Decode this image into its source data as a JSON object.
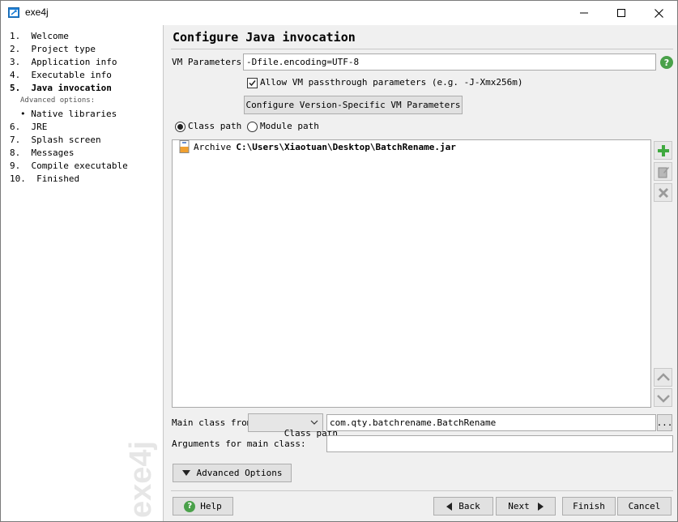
{
  "window": {
    "title": "exe4j"
  },
  "sidebar": {
    "steps": [
      {
        "label": "1.  Welcome"
      },
      {
        "label": "2.  Project type"
      },
      {
        "label": "3.  Application info"
      },
      {
        "label": "4.  Executable info"
      },
      {
        "label": "5.  Java invocation"
      },
      {
        "label": "6.  JRE"
      },
      {
        "label": "7.  Splash screen"
      },
      {
        "label": "8.  Messages"
      },
      {
        "label": "9.  Compile executable"
      },
      {
        "label": "10.  Finished"
      }
    ],
    "advanced_label": "Advanced options:",
    "sub_item": "• Native libraries",
    "watermark": "exe4j"
  },
  "main": {
    "title": "Configure Java invocation",
    "vm_params_label": "VM Parameters:",
    "vm_params_value": "-Dfile.encoding=UTF-8",
    "help_glyph": "?",
    "passthrough_label": "Allow VM passthrough parameters (e.g. -J-Xmx256m)",
    "passthrough_checked": true,
    "configure_version_button": "Configure Version-Specific VM Parameters",
    "classpath_radio": "Class path",
    "modulepath_radio": "Module path",
    "classpath_entries": [
      {
        "type": "Archive",
        "path": "C:\\Users\\Xiaotuan\\Desktop\\BatchRename.jar"
      }
    ],
    "main_class_label": "Main class from",
    "main_class_source": "Class path",
    "main_class_value": "com.qty.batchrename.BatchRename",
    "browse_button": "...",
    "arguments_label": "Arguments for main class:",
    "arguments_value": "",
    "advanced_options_button": "Advanced Options"
  },
  "footer": {
    "help": "Help",
    "back": "Back",
    "next": "Next",
    "finish": "Finish",
    "cancel": "Cancel"
  },
  "colors": {
    "add_icon": "#3fa93f",
    "help_icon": "#4aa14a",
    "disabled_icon": "#9a9a9a",
    "app_icon": "#1e7fd6"
  }
}
